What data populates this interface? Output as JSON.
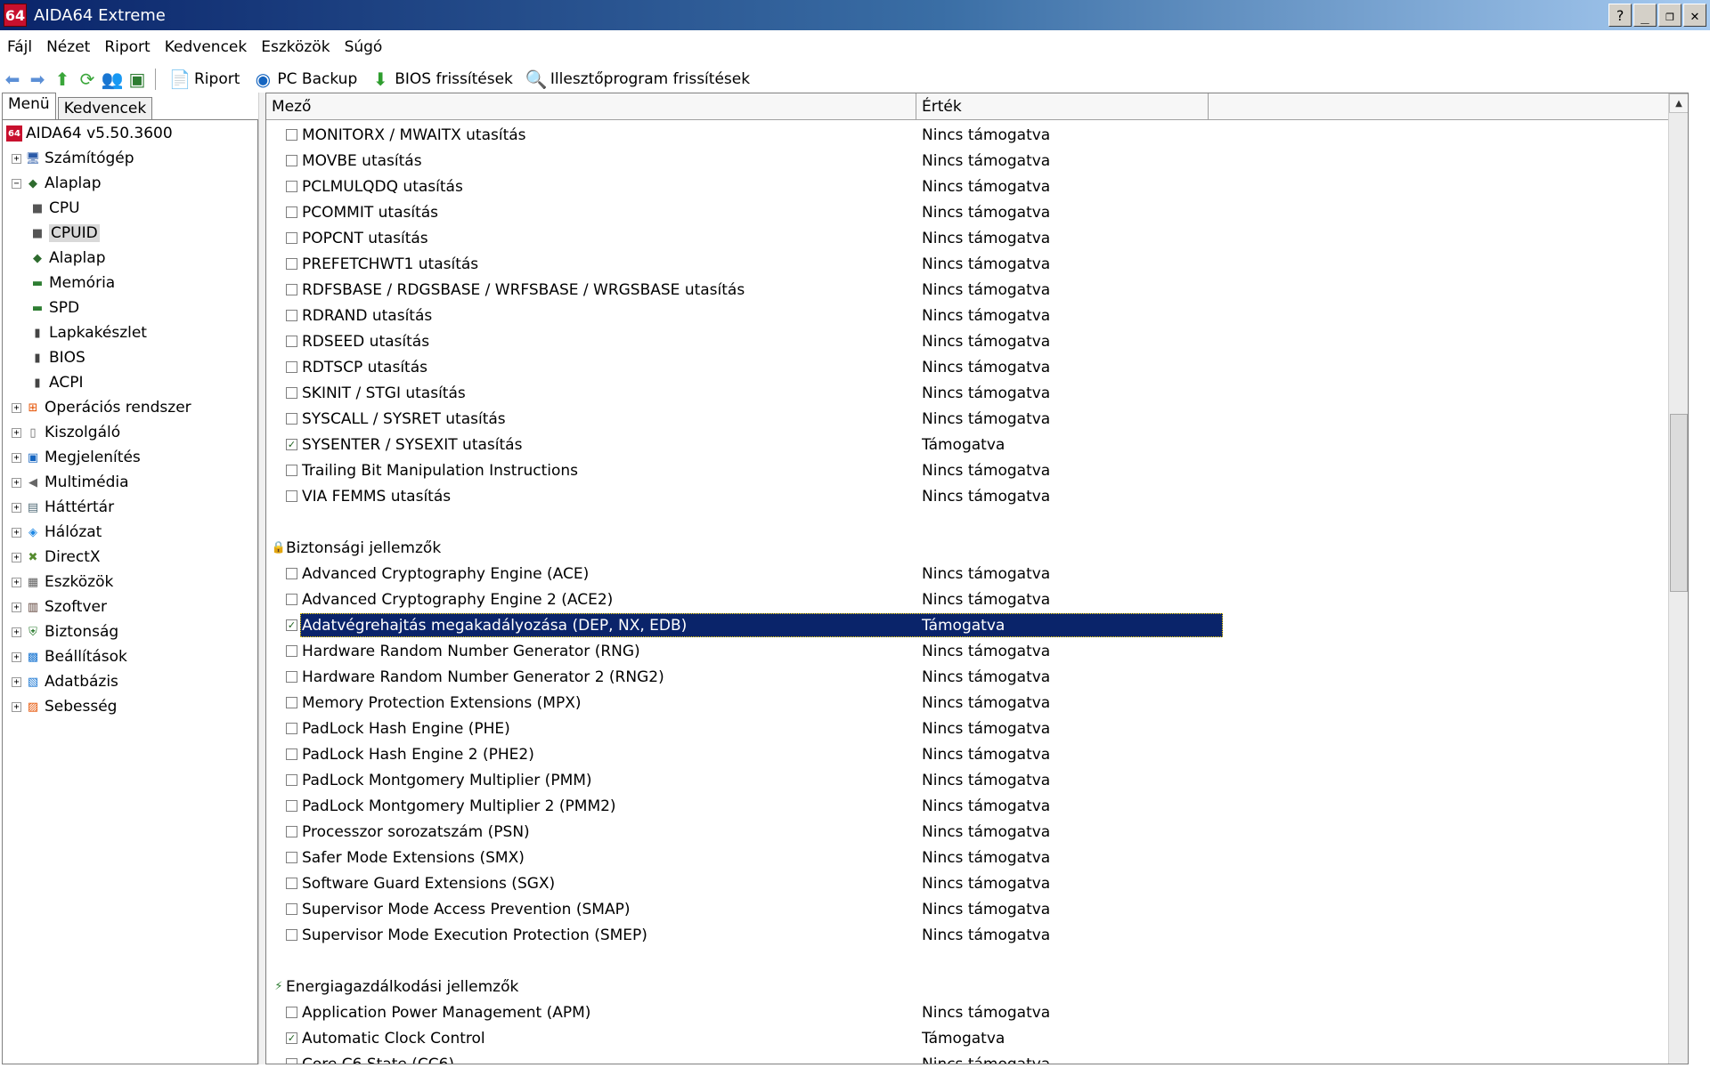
{
  "window": {
    "app_icon": "64",
    "title": "AIDA64 Extreme",
    "btn_help": "?",
    "btn_min": "_",
    "btn_max": "❐",
    "btn_close": "✕"
  },
  "menu": [
    "Fájl",
    "Nézet",
    "Riport",
    "Kedvencek",
    "Eszközök",
    "Súgó"
  ],
  "toolbar": {
    "report": "Riport",
    "pc_backup": "PC Backup",
    "bios_updates": "BIOS frissítések",
    "driver_updates": "Illesztőprogram frissítések"
  },
  "left_tabs": [
    "Menü",
    "Kedvencek"
  ],
  "tree": [
    {
      "label": "AIDA64 v5.50.3600",
      "level": 0,
      "expander": "",
      "icon": "aida64-icon",
      "glyph": "64",
      "color": "#c8102e"
    },
    {
      "label": "Számítógép",
      "level": 1,
      "expander": "+",
      "icon": "computer-icon",
      "glyph": "🖥",
      "color": "#2a5aa8"
    },
    {
      "label": "Alaplap",
      "level": 1,
      "expander": "−",
      "icon": "motherboard-icon",
      "glyph": "◆",
      "color": "#2e6b2e"
    },
    {
      "label": "CPU",
      "level": 2,
      "expander": "",
      "icon": "cpu-icon",
      "glyph": "■",
      "color": "#555555"
    },
    {
      "label": "CPUID",
      "level": 2,
      "expander": "",
      "icon": "cpuid-icon",
      "glyph": "■",
      "color": "#555555",
      "selected": true
    },
    {
      "label": "Alaplap",
      "level": 2,
      "expander": "",
      "icon": "motherboard-icon",
      "glyph": "◆",
      "color": "#2e6b2e"
    },
    {
      "label": "Memória",
      "level": 2,
      "expander": "",
      "icon": "memory-icon",
      "glyph": "▬",
      "color": "#2e7d32"
    },
    {
      "label": "SPD",
      "level": 2,
      "expander": "",
      "icon": "spd-icon",
      "glyph": "▬",
      "color": "#2e7d32"
    },
    {
      "label": "Lapkakészlet",
      "level": 2,
      "expander": "",
      "icon": "chipset-icon",
      "glyph": "▮",
      "color": "#444444"
    },
    {
      "label": "BIOS",
      "level": 2,
      "expander": "",
      "icon": "bios-icon",
      "glyph": "▮",
      "color": "#444444"
    },
    {
      "label": "ACPI",
      "level": 2,
      "expander": "",
      "icon": "acpi-icon",
      "glyph": "▮",
      "color": "#444444"
    },
    {
      "label": "Operációs rendszer",
      "level": 1,
      "expander": "+",
      "icon": "windows-icon",
      "glyph": "⊞",
      "color": "#e65100"
    },
    {
      "label": "Kiszolgáló",
      "level": 1,
      "expander": "+",
      "icon": "server-icon",
      "glyph": "▯",
      "color": "#666666"
    },
    {
      "label": "Megjelenítés",
      "level": 1,
      "expander": "+",
      "icon": "display-icon",
      "glyph": "▣",
      "color": "#1565c0"
    },
    {
      "label": "Multimédia",
      "level": 1,
      "expander": "+",
      "icon": "speaker-icon",
      "glyph": "◀",
      "color": "#666666"
    },
    {
      "label": "Háttértár",
      "level": 1,
      "expander": "+",
      "icon": "storage-icon",
      "glyph": "▤",
      "color": "#546e7a"
    },
    {
      "label": "Hálózat",
      "level": 1,
      "expander": "+",
      "icon": "network-icon",
      "glyph": "◈",
      "color": "#1e88e5"
    },
    {
      "label": "DirectX",
      "level": 1,
      "expander": "+",
      "icon": "directx-icon",
      "glyph": "✖",
      "color": "#558b2f"
    },
    {
      "label": "Eszközök",
      "level": 1,
      "expander": "+",
      "icon": "devices-icon",
      "glyph": "▦",
      "color": "#616161"
    },
    {
      "label": "Szoftver",
      "level": 1,
      "expander": "+",
      "icon": "software-icon",
      "glyph": "▥",
      "color": "#5d4037"
    },
    {
      "label": "Biztonság",
      "level": 1,
      "expander": "+",
      "icon": "shield-icon",
      "glyph": "⛨",
      "color": "#2e7d32"
    },
    {
      "label": "Beállítások",
      "level": 1,
      "expander": "+",
      "icon": "settings-icon",
      "glyph": "▩",
      "color": "#1976d2"
    },
    {
      "label": "Adatbázis",
      "level": 1,
      "expander": "+",
      "icon": "database-icon",
      "glyph": "▧",
      "color": "#1976d2"
    },
    {
      "label": "Sebesség",
      "level": 1,
      "expander": "+",
      "icon": "benchmark-icon",
      "glyph": "▨",
      "color": "#e65100"
    }
  ],
  "columns": {
    "field": "Mező",
    "value": "Érték"
  },
  "rows": [
    {
      "type": "item",
      "field": "MONITORX / MWAITX utasítás",
      "value": "Nincs támogatva",
      "checked": false
    },
    {
      "type": "item",
      "field": "MOVBE utasítás",
      "value": "Nincs támogatva",
      "checked": false
    },
    {
      "type": "item",
      "field": "PCLMULQDQ utasítás",
      "value": "Nincs támogatva",
      "checked": false
    },
    {
      "type": "item",
      "field": "PCOMMIT utasítás",
      "value": "Nincs támogatva",
      "checked": false
    },
    {
      "type": "item",
      "field": "POPCNT utasítás",
      "value": "Nincs támogatva",
      "checked": false
    },
    {
      "type": "item",
      "field": "PREFETCHWT1 utasítás",
      "value": "Nincs támogatva",
      "checked": false
    },
    {
      "type": "item",
      "field": "RDFSBASE / RDGSBASE / WRFSBASE / WRGSBASE utasítás",
      "value": "Nincs támogatva",
      "checked": false
    },
    {
      "type": "item",
      "field": "RDRAND utasítás",
      "value": "Nincs támogatva",
      "checked": false
    },
    {
      "type": "item",
      "field": "RDSEED utasítás",
      "value": "Nincs támogatva",
      "checked": false
    },
    {
      "type": "item",
      "field": "RDTSCP utasítás",
      "value": "Nincs támogatva",
      "checked": false
    },
    {
      "type": "item",
      "field": "SKINIT / STGI utasítás",
      "value": "Nincs támogatva",
      "checked": false
    },
    {
      "type": "item",
      "field": "SYSCALL / SYSRET utasítás",
      "value": "Nincs támogatva",
      "checked": false
    },
    {
      "type": "item",
      "field": "SYSENTER / SYSEXIT utasítás",
      "value": "Támogatva",
      "checked": true
    },
    {
      "type": "item",
      "field": "Trailing Bit Manipulation Instructions",
      "value": "Nincs támogatva",
      "checked": false
    },
    {
      "type": "item",
      "field": "VIA FEMMS utasítás",
      "value": "Nincs támogatva",
      "checked": false
    },
    {
      "type": "blank"
    },
    {
      "type": "section",
      "label": "Biztonsági jellemzők",
      "icon": "lock-icon"
    },
    {
      "type": "item",
      "field": "Advanced Cryptography Engine (ACE)",
      "value": "Nincs támogatva",
      "checked": false
    },
    {
      "type": "item",
      "field": "Advanced Cryptography Engine 2 (ACE2)",
      "value": "Nincs támogatva",
      "checked": false
    },
    {
      "type": "item",
      "field": "Adatvégrehajtás megakadályozása (DEP, NX, EDB)",
      "value": "Támogatva",
      "checked": true,
      "selected": true
    },
    {
      "type": "item",
      "field": "Hardware Random Number Generator (RNG)",
      "value": "Nincs támogatva",
      "checked": false
    },
    {
      "type": "item",
      "field": "Hardware Random Number Generator 2 (RNG2)",
      "value": "Nincs támogatva",
      "checked": false
    },
    {
      "type": "item",
      "field": "Memory Protection Extensions (MPX)",
      "value": "Nincs támogatva",
      "checked": false
    },
    {
      "type": "item",
      "field": "PadLock Hash Engine (PHE)",
      "value": "Nincs támogatva",
      "checked": false
    },
    {
      "type": "item",
      "field": "PadLock Hash Engine 2 (PHE2)",
      "value": "Nincs támogatva",
      "checked": false
    },
    {
      "type": "item",
      "field": "PadLock Montgomery Multiplier (PMM)",
      "value": "Nincs támogatva",
      "checked": false
    },
    {
      "type": "item",
      "field": "PadLock Montgomery Multiplier 2 (PMM2)",
      "value": "Nincs támogatva",
      "checked": false
    },
    {
      "type": "item",
      "field": "Processzor sorozatszám (PSN)",
      "value": "Nincs támogatva",
      "checked": false
    },
    {
      "type": "item",
      "field": "Safer Mode Extensions (SMX)",
      "value": "Nincs támogatva",
      "checked": false
    },
    {
      "type": "item",
      "field": "Software Guard Extensions (SGX)",
      "value": "Nincs támogatva",
      "checked": false
    },
    {
      "type": "item",
      "field": "Supervisor Mode Access Prevention (SMAP)",
      "value": "Nincs támogatva",
      "checked": false
    },
    {
      "type": "item",
      "field": "Supervisor Mode Execution Protection (SMEP)",
      "value": "Nincs támogatva",
      "checked": false
    },
    {
      "type": "blank"
    },
    {
      "type": "section",
      "label": "Energiagazdálkodási jellemzők",
      "icon": "power-icon"
    },
    {
      "type": "item",
      "field": "Application Power Management (APM)",
      "value": "Nincs támogatva",
      "checked": false
    },
    {
      "type": "item",
      "field": "Automatic Clock Control",
      "value": "Támogatva",
      "checked": true
    },
    {
      "type": "item",
      "field": "Core C6 State (CC6)",
      "value": "Nincs támogatva",
      "checked": false
    }
  ]
}
